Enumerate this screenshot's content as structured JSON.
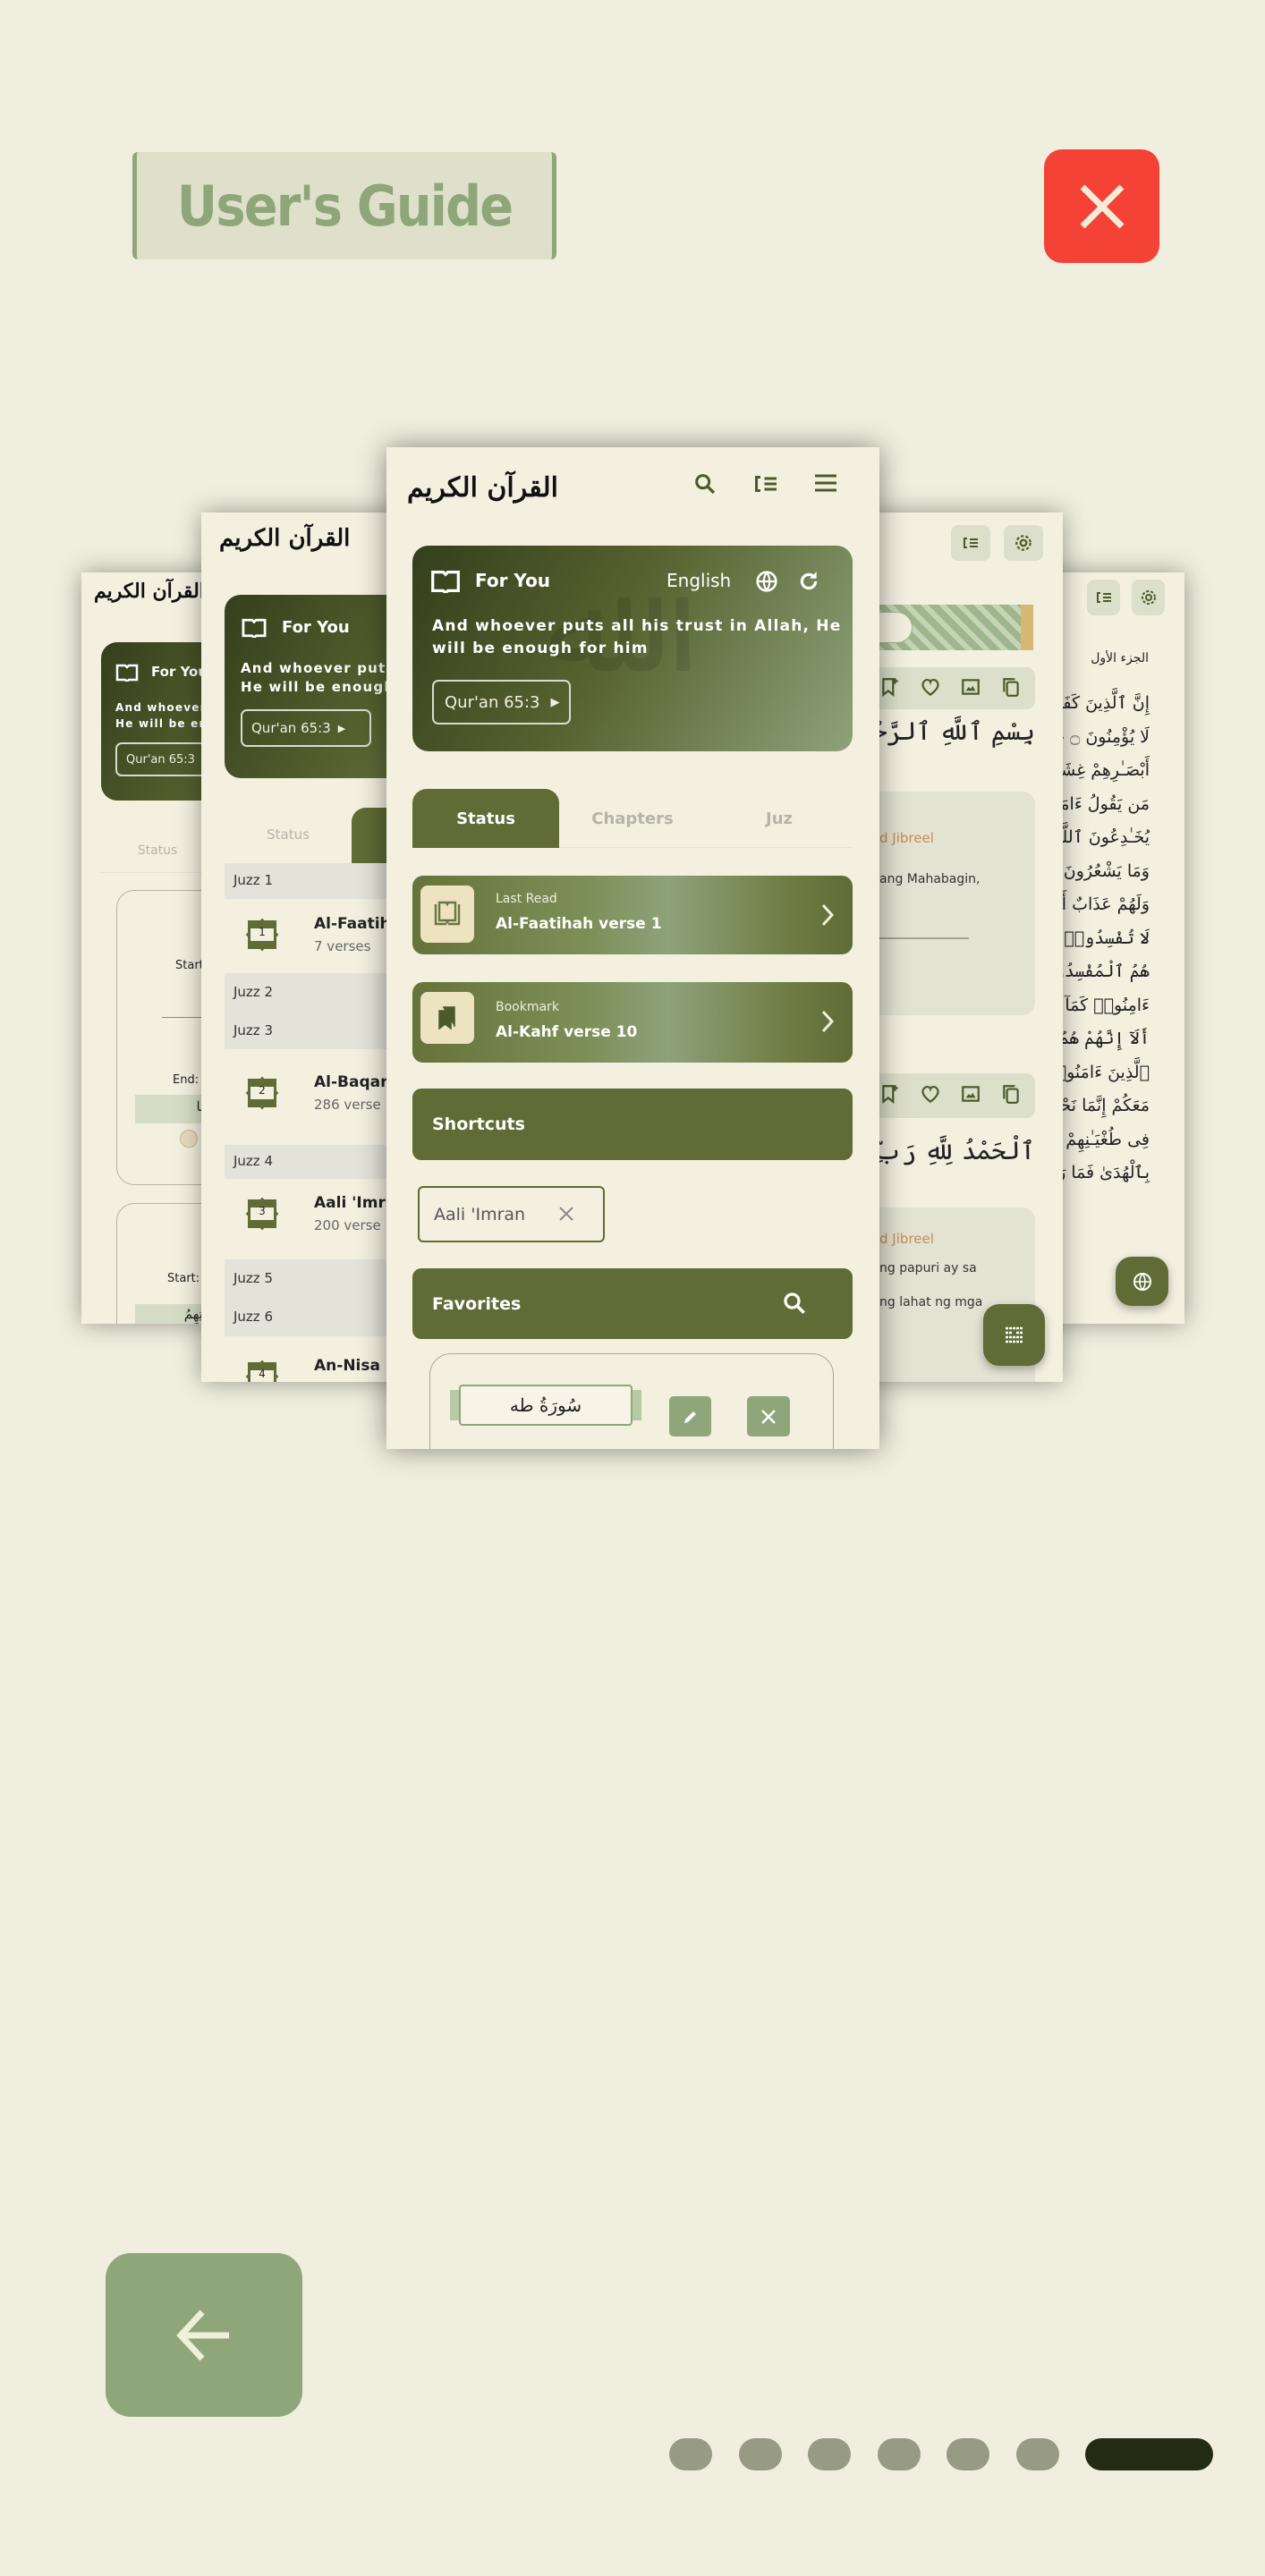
{
  "guide": {
    "title": "User's Guide",
    "close_icon": "close-icon",
    "back_icon": "arrow-left-icon",
    "pagination": {
      "total": 7,
      "active": 7
    }
  },
  "colors": {
    "background": "#f0efdf",
    "primary": "#606b35",
    "accent_light": "#8fa67a",
    "close": "#f44336",
    "active_dot": "#232b14",
    "reciter": "#c98a55"
  },
  "app": {
    "logo": "القرآن الكريم",
    "header_icons": [
      "search-icon",
      "playlist-icon",
      "menu-icon"
    ],
    "for_you": {
      "title": "For You",
      "language": "English",
      "quote": "And whoever puts all his trust in Allah, He will be enough for him",
      "reference": "Qur'an 65:3"
    },
    "tabs": [
      "Status",
      "Chapters",
      "Juz"
    ],
    "active_tab": "Status",
    "last_read": {
      "label": "Last Read",
      "value": "Al-Faatihah verse 1"
    },
    "bookmark": {
      "label": "Bookmark",
      "value": "Al-Kahf verse 10"
    },
    "shortcuts": {
      "title": "Shortcuts",
      "chips": [
        "Aali 'Imran"
      ]
    },
    "favorites": {
      "title": "Favorites",
      "items": [
        {
          "surah": "سُورَةُ طه"
        }
      ]
    }
  },
  "chapters_card": {
    "status_tab": "Status",
    "juz_1": "Juzz 1",
    "juz_2": "Juzz 2",
    "juz_3": "Juzz 3",
    "juz_4": "Juzz 4",
    "juz_5": "Juzz 5",
    "juz_6": "Juzz 6",
    "chapters": [
      {
        "number": "1",
        "name": "Al-Faatih",
        "verses": "7 verses"
      },
      {
        "number": "2",
        "name": "Al-Baqar",
        "verses": "286 verse"
      },
      {
        "number": "3",
        "name": "Aali 'Imr",
        "verses": "200 verse"
      },
      {
        "number": "4",
        "name": "An-Nisa"
      }
    ]
  },
  "status_card": {
    "tab": "Status",
    "start_label": "Start",
    "end_label": "End:",
    "arabic_end": "وَلَكُم مَّا",
    "start_label_2": "Start:",
    "arabic_start_2": "عَن قِبْلَتِهِمُ"
  },
  "reader_card": {
    "bismillah": "بِسْمِ ٱللَّهِ ٱلرَّحْمَـٰنِ ٱلرَّ",
    "verse_2": "ٱلْحَمْدُ لِلَّهِ رَبِّ ٱلْعَـٰ",
    "reciter_1": "d Jibreel",
    "translation_1": "ang Mahabagin,",
    "reciter_2": "d Jibreel",
    "translation_2_line1": "ng papuri ay sa",
    "translation_2_line2": "ng lahat ng mga",
    "action_icons": [
      "bookmark-add-icon",
      "heart-icon",
      "image-icon",
      "copy-icon"
    ]
  },
  "mushaf_card": {
    "juz_heading": "الجزء الأول",
    "lines": [
      "إِنَّ ٱلَّذِينَ كَفَرُوا",
      "لَا يُؤْمِنُونَ ۝ خَتَ",
      "أَبْصَـٰرِهِمْ غِشَـٰوَةٌ",
      "مَن يَقُولُ ءَامَنَّا بِ",
      "يُخَـٰدِعُونَ ٱللَّهَ وَٱلَّ",
      "وَمَا يَشْعُرُونَ ۝",
      "وَلَهُمْ عَذَابٌ أَلِي",
      "لَا تُفْسِدُوا۟ فِى ٱلْأَ",
      "هُمُ ٱلْمُفْسِدُونَ",
      "ءَامِنُوا۟ كَمَآ ءَا",
      "أَلَآ إِنَّهُمْ هُمُ ٱلسُّ",
      "ٱلَّذِينَ ءَامَنُوا۟ قَالُ",
      "مَعَكُمْ إِنَّمَا نَحْنُ",
      "فِى طُغْيَـٰنِهِمْ يَعْمَ",
      "بِٱلْهُدَىٰ فَمَا رَبِحَ"
    ]
  }
}
